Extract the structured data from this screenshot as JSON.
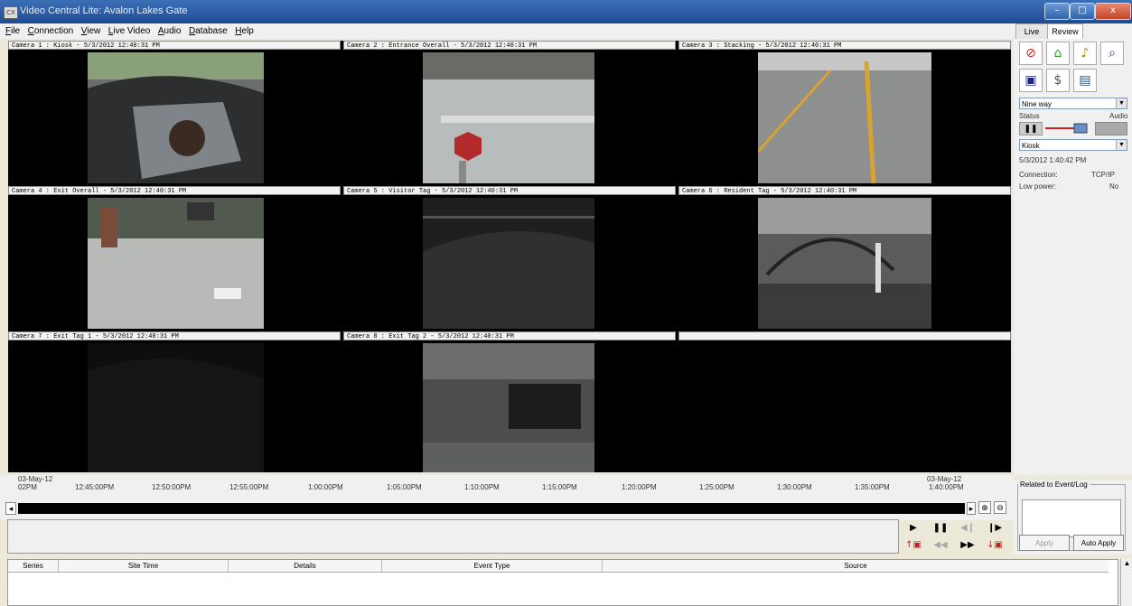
{
  "window": {
    "title": "Video Central Lite: Avalon Lakes Gate",
    "minimize": "–",
    "maximize": "□",
    "close": "x"
  },
  "menu": [
    "File",
    "Connection",
    "View",
    "Live Video",
    "Audio",
    "Database",
    "Help"
  ],
  "cameras": [
    {
      "label": "Camera 1 : Kiosk - 5/3/2012 12:40:31 PM"
    },
    {
      "label": "Camera 2 : Entrance Overall - 5/3/2012 12:40:31 PM"
    },
    {
      "label": "Camera 3 : Stacking - 5/3/2012 12:40:31 PM"
    },
    {
      "label": "Camera 4 : Exit Overall - 5/3/2012 12:40:31 PM"
    },
    {
      "label": "Camera 5 : Visitor Tag - 5/3/2012 12:40:31 PM"
    },
    {
      "label": "Camera 6 : Resident Tag - 5/3/2012 12:40:31 PM"
    },
    {
      "label": "Camera 7 : Exit Tag 1 - 5/3/2012 12:40:31 PM"
    },
    {
      "label": "Camera 8 : Exit Tag 2 - 5/3/2012 12:40:31 PM"
    }
  ],
  "right_panel": {
    "tabs": [
      "Live",
      "Review"
    ],
    "active_tab": "Review",
    "layout_select": "Nine way",
    "status_label": "Status",
    "audio_label": "Audio",
    "camera_select": "Kiosk",
    "datetime": "5/3/2012 1:40:42 PM",
    "connection_label": "Connection:",
    "connection_value": "TCP/IP",
    "low_power_label": "Low power:",
    "low_power_value": "No"
  },
  "timeline": {
    "start_date": "03-May-12",
    "start_time": "02PM",
    "end_date": "03-May-12",
    "end_time": "1:40:00PM",
    "ticks": [
      "12:45:00PM",
      "12:50:00PM",
      "12:55:00PM",
      "1:00:00PM",
      "1:05:00PM",
      "1:10:00PM",
      "1:15:00PM",
      "1:20:00PM",
      "1:25:00PM",
      "1:30:00PM",
      "1:35:00PM"
    ]
  },
  "related_panel": {
    "title": "Related to Event/Log",
    "apply": "Apply",
    "auto_apply": "Auto Apply"
  },
  "events_table": {
    "columns": [
      "Series",
      "Site Time",
      "Details",
      "Event Type",
      "Source"
    ]
  },
  "colors": {
    "title_bar": "#2a5aa3",
    "timeline_bar": "#000000",
    "cable_red": "#cc2222"
  }
}
